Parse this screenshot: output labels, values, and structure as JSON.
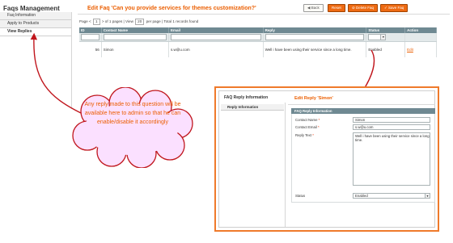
{
  "sidebar": {
    "title": "Faqs Management",
    "items": [
      {
        "label": "Faq Information"
      },
      {
        "label": "Apply to Products"
      },
      {
        "label": "View Replies"
      }
    ]
  },
  "header": {
    "title": "Edit Faq 'Can you provide services for themes customization?'",
    "buttons": {
      "back": "Back",
      "reset": "Reset",
      "delete": "Delete Faq",
      "save": "Save Faq"
    }
  },
  "pager": {
    "page_label": "Page",
    "page_value": "1",
    "of_pages": "of 1 pages",
    "view_label": "View",
    "view_value": "20",
    "per_page": "per page",
    "total": "Total 1 records found"
  },
  "grid": {
    "columns": [
      "ID",
      "Contact Name",
      "Email",
      "Reply",
      "Status",
      "Action"
    ],
    "rows": [
      {
        "id": "56",
        "name": "Simon",
        "email": "s.w@u.com",
        "reply": "Well i have been using their service since a long time.",
        "status": "Enabled",
        "action": "Edit"
      }
    ]
  },
  "callout": {
    "text": "Any reply made to this question will be available here to admin so that he can enable/disable it accordingly"
  },
  "inset": {
    "sidebar_title": "FAQ Reply Information",
    "sidebar_tab": "Reply Information",
    "title": "Edit Reply 'Simon'",
    "fieldset_title": "FAQ Reply Information",
    "fields": {
      "name_label": "Contact Name",
      "name_value": "Simon",
      "email_label": "Contact Email",
      "email_value": "s.w@u.com",
      "reply_label": "Reply Text",
      "reply_value": "Well i have been using their service since a long time.",
      "status_label": "Status",
      "status_value": "Enabled"
    },
    "required_mark": "*"
  },
  "colors": {
    "accent": "#eb5e00",
    "grid_header": "#6f8992",
    "button": "#ee6a12"
  }
}
